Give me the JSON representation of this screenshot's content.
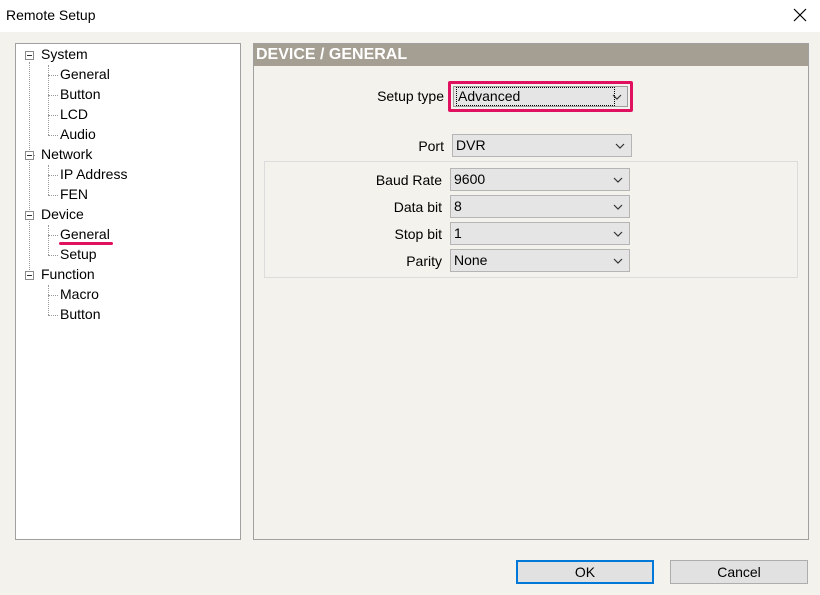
{
  "window": {
    "title": "Remote Setup"
  },
  "tree": {
    "groups": [
      {
        "label": "System",
        "children": [
          "General",
          "Button",
          "LCD",
          "Audio"
        ]
      },
      {
        "label": "Network",
        "children": [
          "IP Address",
          "FEN"
        ]
      },
      {
        "label": "Device",
        "children": [
          "General",
          "Setup"
        ]
      },
      {
        "label": "Function",
        "children": [
          "Macro",
          "Button"
        ]
      }
    ],
    "selected": "Device / General"
  },
  "panel": {
    "header": "DEVICE / GENERAL",
    "setup_type": {
      "label": "Setup type",
      "value": "Advanced"
    },
    "port": {
      "label": "Port",
      "value": "DVR"
    },
    "baud_rate": {
      "label": "Baud Rate",
      "value": "9600"
    },
    "data_bit": {
      "label": "Data bit",
      "value": "8"
    },
    "stop_bit": {
      "label": "Stop bit",
      "value": "1"
    },
    "parity": {
      "label": "Parity",
      "value": "None"
    }
  },
  "buttons": {
    "ok": "OK",
    "cancel": "Cancel"
  },
  "colors": {
    "highlight": "#e0115f",
    "header_bg": "#a59f93",
    "default_button_border": "#0078d7"
  }
}
